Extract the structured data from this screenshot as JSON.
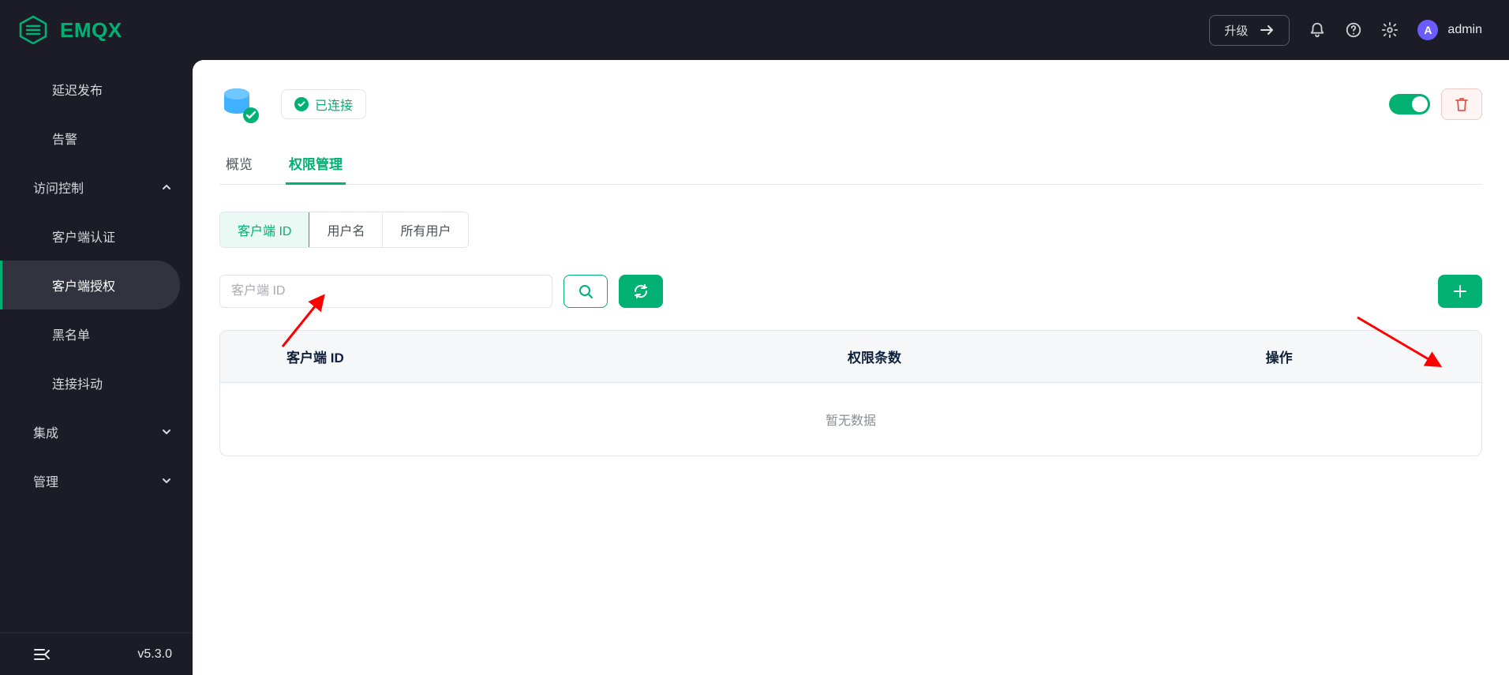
{
  "brand": {
    "name": "EMQX",
    "version": "v5.3.0"
  },
  "header": {
    "upgrade_label": "升级",
    "user_initial": "A",
    "user_name": "admin"
  },
  "sidebar": {
    "items": [
      {
        "label": "延迟发布",
        "type": "item"
      },
      {
        "label": "告警",
        "type": "item"
      },
      {
        "label": "访问控制",
        "type": "group",
        "expanded": true
      },
      {
        "label": "客户端认证",
        "type": "sub"
      },
      {
        "label": "客户端授权",
        "type": "sub",
        "active": true
      },
      {
        "label": "黑名单",
        "type": "sub"
      },
      {
        "label": "连接抖动",
        "type": "sub"
      },
      {
        "label": "集成",
        "type": "group",
        "expanded": false
      },
      {
        "label": "管理",
        "type": "group",
        "expanded": false
      }
    ]
  },
  "source": {
    "status_label": "已连接",
    "enabled": true
  },
  "tabs": [
    {
      "label": "概览",
      "active": false
    },
    {
      "label": "权限管理",
      "active": true
    }
  ],
  "segments": [
    {
      "label": "客户端 ID",
      "active": true
    },
    {
      "label": "用户名",
      "active": false
    },
    {
      "label": "所有用户",
      "active": false
    }
  ],
  "search": {
    "placeholder": "客户端 ID"
  },
  "table": {
    "columns": [
      "客户端 ID",
      "权限条数",
      "操作"
    ],
    "empty_text": "暂无数据"
  }
}
